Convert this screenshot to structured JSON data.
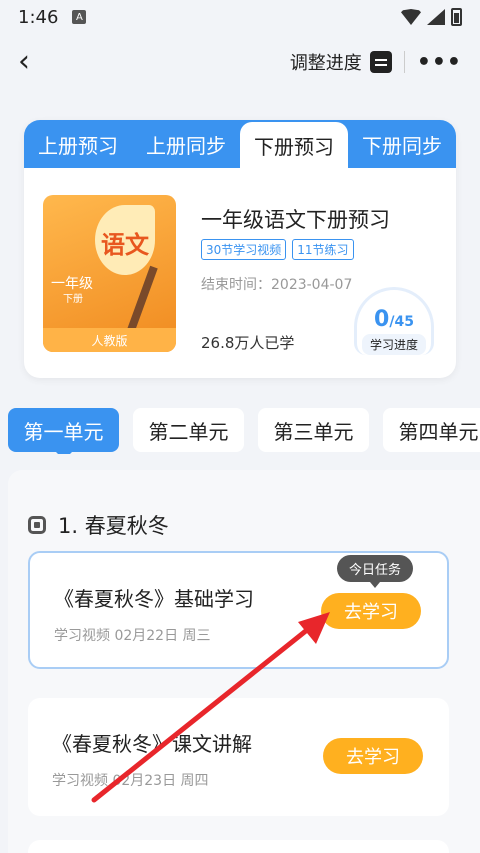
{
  "status": {
    "time": "1:46",
    "notif_glyph": "A"
  },
  "nav": {
    "back_glyph": "‹",
    "adjust_label": "调整进度",
    "more_glyph": "•••"
  },
  "tabs": [
    {
      "label": "上册预习",
      "active": false
    },
    {
      "label": "上册同步",
      "active": false
    },
    {
      "label": "下册预习",
      "active": true
    },
    {
      "label": "下册同步",
      "active": false
    }
  ],
  "course": {
    "cover": {
      "subject": "语文",
      "grade": "一年级",
      "volume": "下册",
      "edition": "人教版"
    },
    "title": "一年级语文下册预习",
    "tags": [
      "30节学习视频",
      "11节练习"
    ],
    "end_time": "结束时间：2023-04-07",
    "learned": "26.8万人已学",
    "progress": {
      "done": "0",
      "total": "/45",
      "label": "学习进度"
    }
  },
  "units": [
    "第一单元",
    "第二单元",
    "第三单元",
    "第四单元"
  ],
  "section": {
    "title": "1. 春夏秋冬"
  },
  "lessons": [
    {
      "title": "《春夏秋冬》基础学习",
      "meta": "学习视频  02月22日  周三",
      "button": "去学习",
      "badge": "今日任务"
    },
    {
      "title": "《春夏秋冬》课文讲解",
      "meta": "学习视频  02月23日  周四",
      "button": "去学习"
    }
  ],
  "colors": {
    "accent": "#3a93f0",
    "button": "#ffb01f",
    "arrow": "#e8262b"
  }
}
